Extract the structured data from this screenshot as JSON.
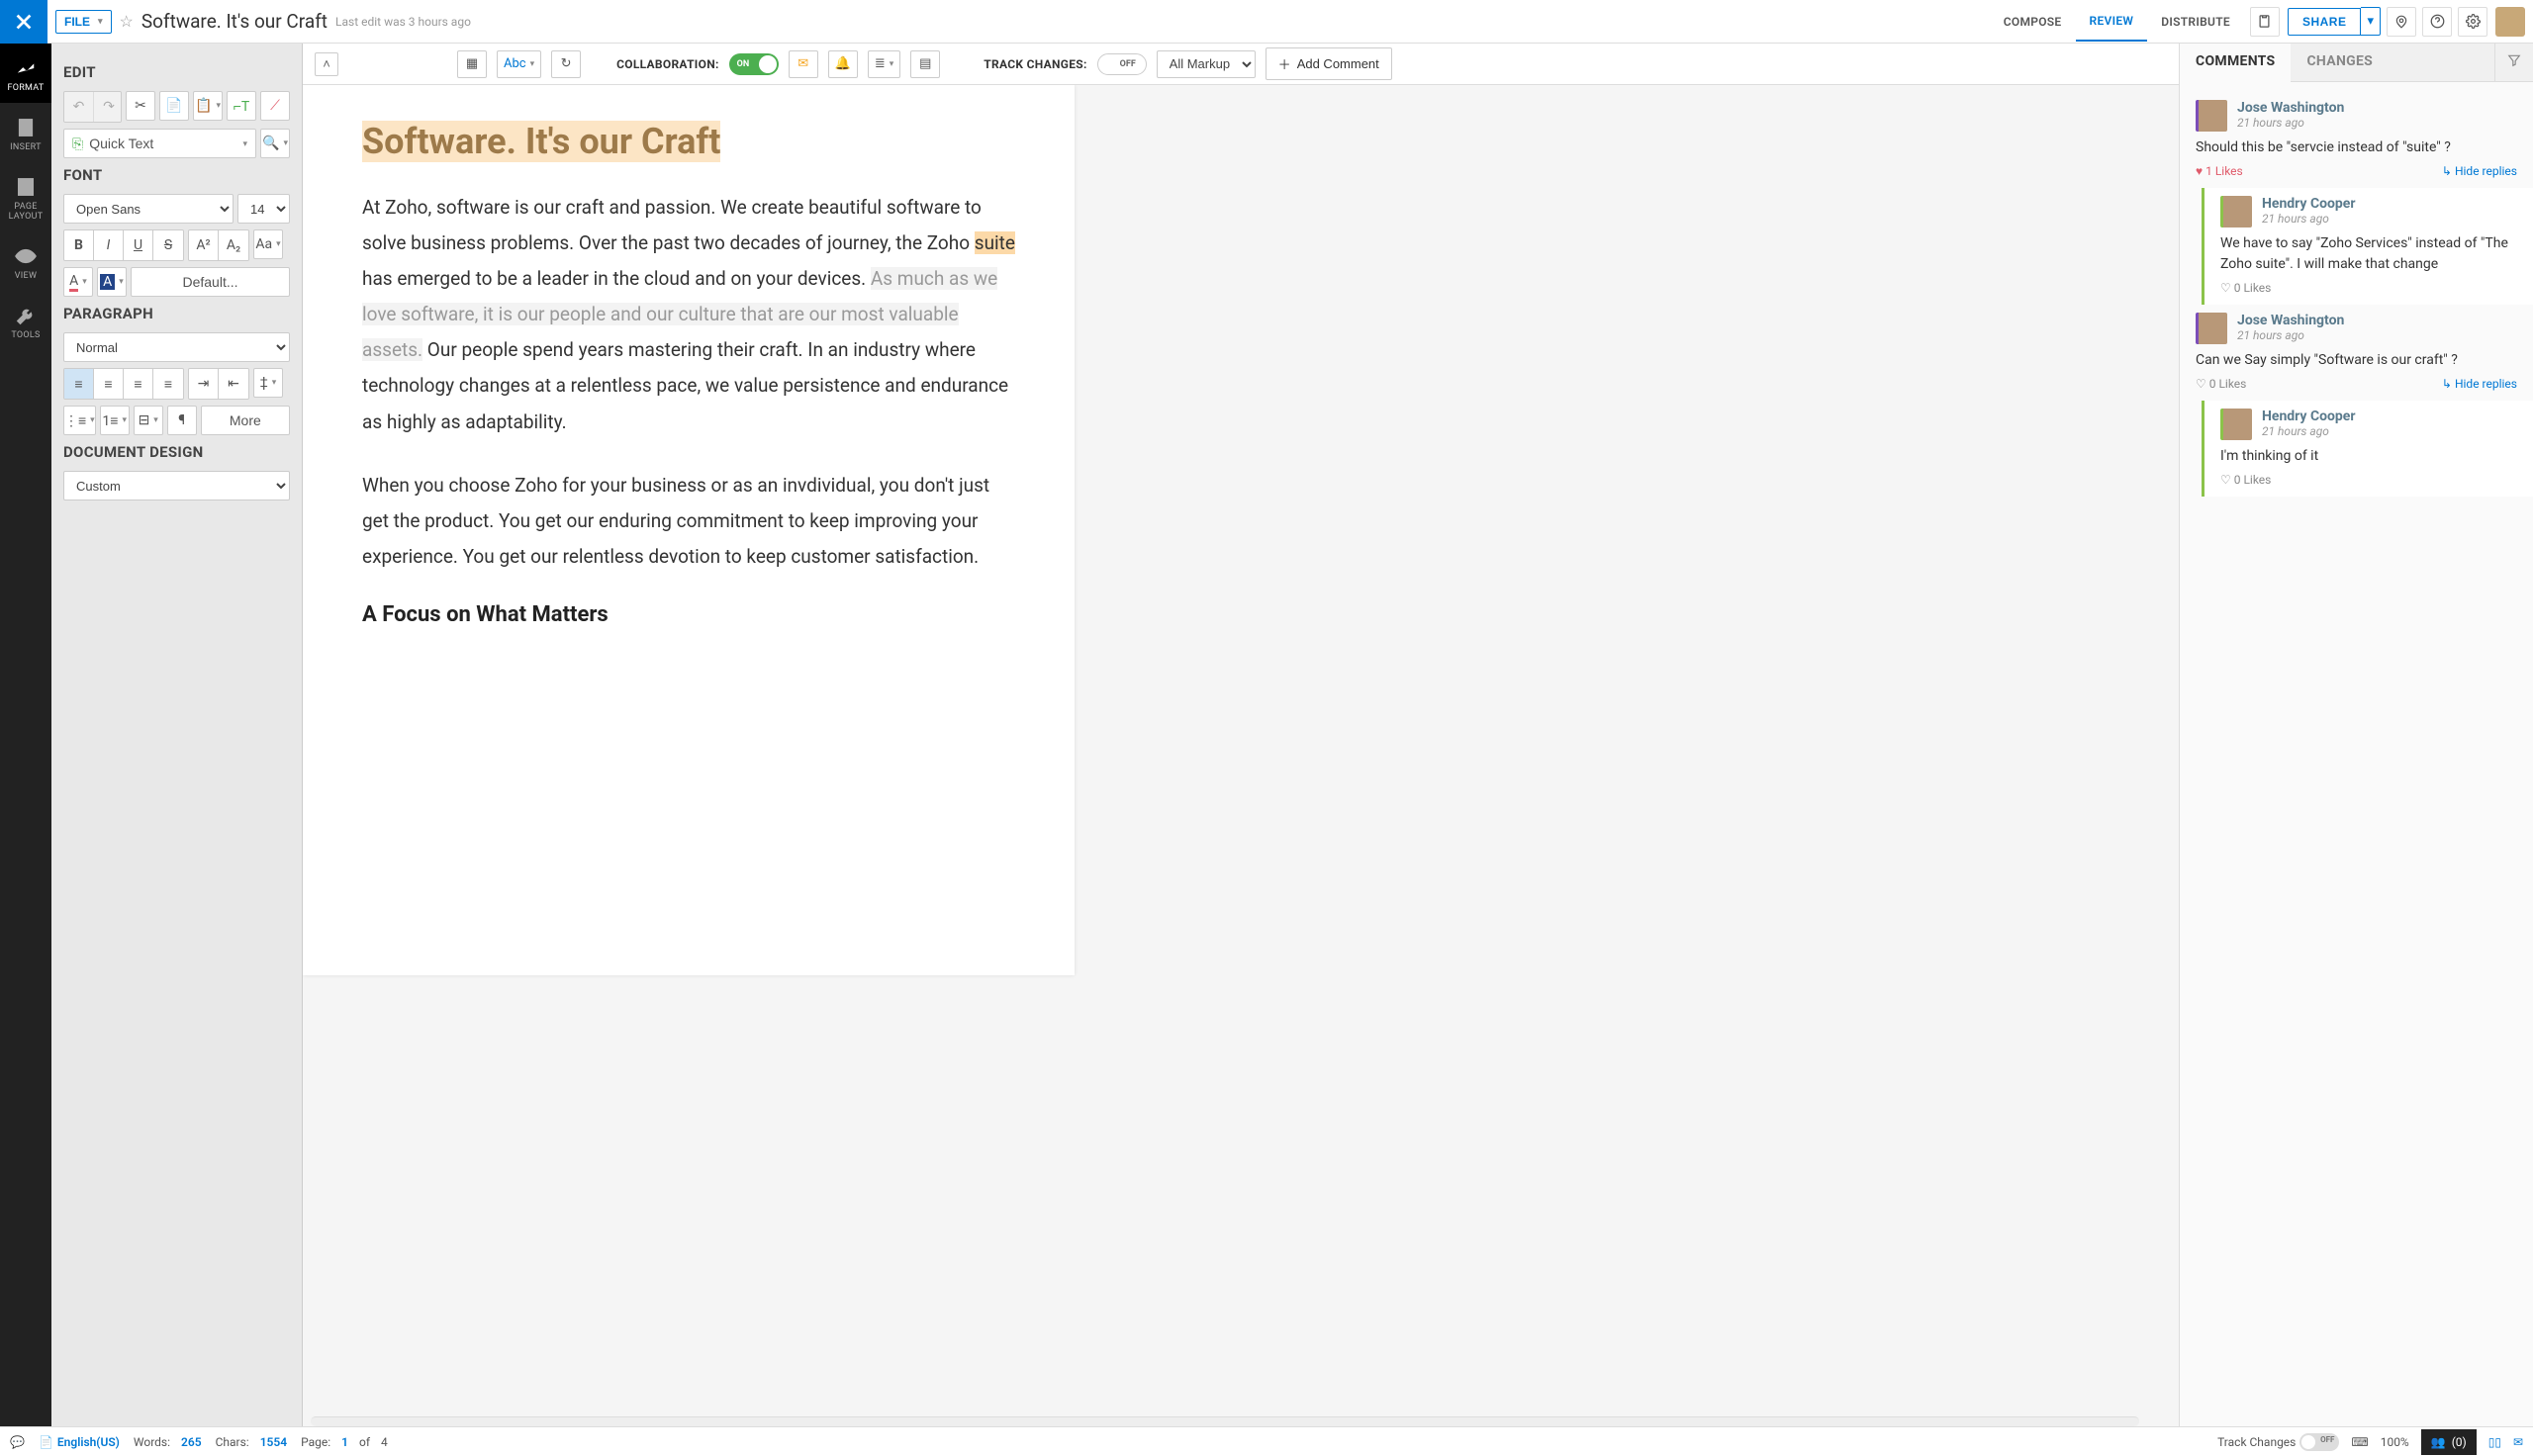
{
  "topbar": {
    "file_label": "FILE",
    "doc_title": "Software. It's our Craft",
    "last_edit": "Last edit was 3 hours ago",
    "compose": "COMPOSE",
    "review": "REVIEW",
    "distribute": "DISTRIBUTE",
    "share": "SHARE"
  },
  "leftstrip": {
    "format": "FORMAT",
    "insert": "INSERT",
    "page_layout": "PAGE\nLAYOUT",
    "view": "VIEW",
    "tools": "TOOLS"
  },
  "sidebar": {
    "edit_title": "EDIT",
    "quick_text": "Quick Text",
    "font_title": "FONT",
    "font_family": "Open Sans",
    "font_size": "14",
    "default_btn": "Default...",
    "para_title": "PARAGRAPH",
    "para_style": "Normal",
    "more": "More",
    "docdesign_title": "DOCUMENT DESIGN",
    "docdesign_value": "Custom"
  },
  "canvas_toolbar": {
    "collaboration": "COLLABORATION:",
    "collab_on": "ON",
    "track_changes": "TRACK CHANGES:",
    "track_off": "OFF",
    "markup": "All Markup",
    "add_comment": "Add Comment"
  },
  "document": {
    "h1": "Software. It's our Craft",
    "p1_a": "At Zoho, software is our craft and passion. We create beautiful software to solve business problems. Over the past two decades of  journey, the Zoho ",
    "p1_hl": "suite",
    "p1_b": " has emerged to be a leader in the cloud and on your devices.   ",
    "p1_track": "As much as we love software, it is our people and our culture that are our most valuable assets.",
    "p1_c": "   Our people spend years mastering their  craft. In an industry where technology changes at a relentless pace, we value persistence and endurance as highly as adaptability.",
    "p2": "When you choose Zoho for your business  or as an invdividual, you don't just get the product. You get our enduring commitment to keep improving your experience.  You get our relentless devotion to keep customer satisfaction.",
    "h2": "A Focus on What Matters"
  },
  "comments_panel": {
    "comments_tab": "COMMENTS",
    "changes_tab": "CHANGES",
    "threads": [
      {
        "author": "Jose Washington",
        "time": "21 hours ago",
        "text": "Should this be \"servcie instead of \"suite\" ?",
        "likes": "1 Likes",
        "liked": true,
        "hide": "Hide replies",
        "reply": false
      },
      {
        "author": "Hendry Cooper",
        "time": "21 hours ago",
        "text": "We have to say \"Zoho Services\" instead of \"The Zoho suite\". I will make that change",
        "likes": "0 Likes",
        "liked": false,
        "reply": true
      },
      {
        "author": "Jose Washington",
        "time": "21 hours ago",
        "text": "Can we Say simply \"Software is our craft\" ?",
        "likes": "0 Likes",
        "liked": false,
        "hide": "Hide replies",
        "reply": false
      },
      {
        "author": "Hendry Cooper",
        "time": "21 hours ago",
        "text": "I'm thinking of it",
        "likes": "0 Likes",
        "liked": false,
        "reply": true
      }
    ]
  },
  "statusbar": {
    "language": "English(US)",
    "words_lbl": "Words:",
    "words": "265",
    "chars_lbl": "Chars:",
    "chars": "1554",
    "page_lbl": "Page:",
    "page": "1",
    "of_lbl": "of",
    "pages": "4",
    "track_lbl": "Track Changes",
    "track_off": "OFF",
    "zoom": "100%",
    "collab_count": "(0)"
  }
}
